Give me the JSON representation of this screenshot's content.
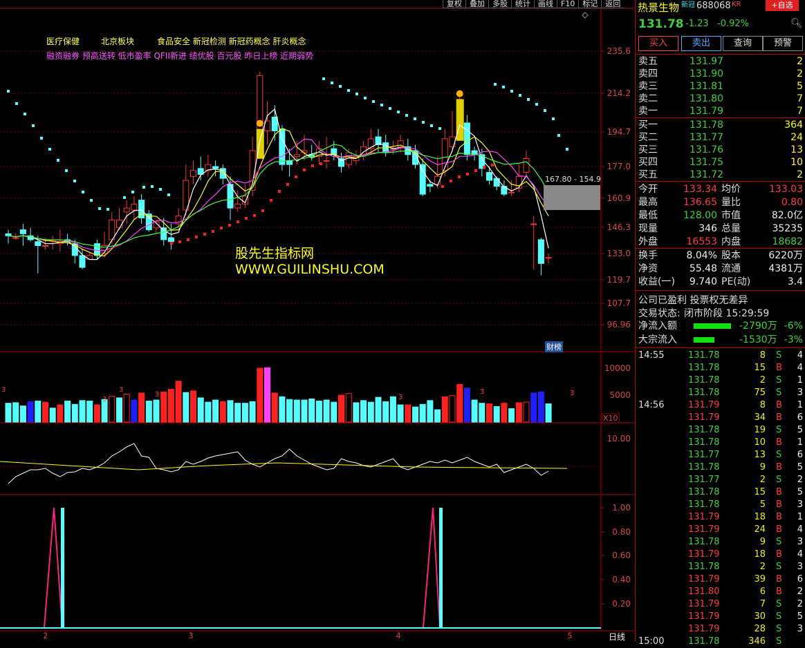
{
  "toolbar": [
    "复权",
    "叠加",
    "多股",
    "统计",
    "画线",
    "F10",
    "标记",
    "返回"
  ],
  "concepts_line1": [
    "医疗保健",
    "北京板块",
    "食品安全 新冠检测 新冠药概念 肝炎概念"
  ],
  "concepts_line2": "融资融券 预高送转 低市盈率 QFII新进 绩优股 百元股 昨日上榜 近期弱势",
  "watermark": {
    "cn": "股先生指标网",
    "url": "WWW.GUILINSHU.COM"
  },
  "price_axis": [
    "235.6",
    "214.2",
    "194.7",
    "177.0",
    "160.9",
    "146.3",
    "133.0",
    "119.7",
    "107.7",
    "96.96"
  ],
  "annotation": "167.80 - 154.9",
  "caibang": "财榜",
  "vol_axis": [
    "10000",
    "5000"
  ],
  "vol_unit": "X10",
  "osc_axis": [
    "10.00"
  ],
  "sig_axis": [
    "1.00",
    "0.80",
    "0.60",
    "0.40",
    "0.20"
  ],
  "x_axis": [
    "2",
    "3",
    "4",
    "5"
  ],
  "period": "日线",
  "vol_marks": [
    "3",
    "3",
    "3",
    "3",
    "3",
    "3",
    "3"
  ],
  "stock": {
    "name": "热景生物",
    "tag": "新冠",
    "code": "688068",
    "suffix": "KR",
    "selfpick": "+自选",
    "price": "131.78",
    "change": "-1.23",
    "pct": "-0.92%"
  },
  "buttons": [
    "买入",
    "卖出",
    "查询",
    "预警"
  ],
  "asks": [
    [
      "卖五",
      "131.97",
      "2"
    ],
    [
      "卖四",
      "131.90",
      "2"
    ],
    [
      "卖三",
      "131.81",
      "5"
    ],
    [
      "卖二",
      "131.80",
      "7"
    ],
    [
      "卖一",
      "131.79",
      "7"
    ]
  ],
  "bids": [
    [
      "买一",
      "131.78",
      "364"
    ],
    [
      "买二",
      "131.77",
      "24"
    ],
    [
      "买三",
      "131.76",
      "13"
    ],
    [
      "买四",
      "131.75",
      "10"
    ],
    [
      "买五",
      "131.72",
      "2"
    ]
  ],
  "stats": [
    [
      "今开",
      "133.34",
      "均价",
      "133.03"
    ],
    [
      "最高",
      "136.65",
      "量比",
      "0.80"
    ],
    [
      "最低",
      "128.00",
      "市值",
      "82.0亿"
    ],
    [
      "现量",
      "346",
      "总量",
      "35235"
    ],
    [
      "外盘",
      "16553",
      "内盘",
      "18682"
    ]
  ],
  "stats2": [
    [
      "换手",
      "8.04%",
      "股本",
      "6220万"
    ],
    [
      "净资",
      "55.48",
      "流通",
      "4381万"
    ],
    [
      "收益(一)",
      "9.740",
      "PE(动)",
      "3.4"
    ]
  ],
  "notice": "公司已盈利 投票权无差异",
  "trade_state": {
    "label": "交易状态:",
    "value": "闭市阶段 15:29:59"
  },
  "flows": [
    [
      "净流入额",
      "-2790万",
      "-6%"
    ],
    [
      "大宗流入",
      "-1530万",
      "-3%"
    ]
  ],
  "ticks": [
    [
      "14:55",
      "131.78",
      "8",
      "S",
      "4"
    ],
    [
      "",
      "131.78",
      "15",
      "B",
      "4"
    ],
    [
      "",
      "131.78",
      "2",
      "S",
      "1"
    ],
    [
      "",
      "131.78",
      "75",
      "S",
      "3"
    ],
    [
      "14:56",
      "131.79",
      "8",
      "B",
      "1"
    ],
    [
      "",
      "131.79",
      "34",
      "B",
      "6"
    ],
    [
      "",
      "131.78",
      "19",
      "S",
      "5"
    ],
    [
      "",
      "131.78",
      "10",
      "B",
      "1"
    ],
    [
      "",
      "131.77",
      "13",
      "S",
      "6"
    ],
    [
      "",
      "131.78",
      "9",
      "B",
      "5"
    ],
    [
      "",
      "131.77",
      "2",
      "S",
      "2"
    ],
    [
      "",
      "131.78",
      "15",
      "B",
      "5"
    ],
    [
      "",
      "131.78",
      "5",
      "B",
      "3"
    ],
    [
      "",
      "131.79",
      "18",
      "B",
      "1"
    ],
    [
      "",
      "131.79",
      "24",
      "B",
      "4"
    ],
    [
      "",
      "131.78",
      "9",
      "S",
      "3"
    ],
    [
      "",
      "131.79",
      "18",
      "B",
      "4"
    ],
    [
      "",
      "131.78",
      "2",
      "S",
      "3"
    ],
    [
      "",
      "131.79",
      "39",
      "B",
      "6"
    ],
    [
      "",
      "131.80",
      "6",
      "B",
      "2"
    ],
    [
      "",
      "131.79",
      "7",
      "S",
      "2"
    ],
    [
      "",
      "131.79",
      "30",
      "S",
      "5"
    ],
    [
      "",
      "131.79",
      "28",
      "S",
      "3"
    ],
    [
      "15:00",
      "131.78",
      "346",
      "S",
      ""
    ]
  ],
  "colors": {
    "up": "#ff3030",
    "down": "#54ffff",
    "grid": "#b00000",
    "ma_white": "#ffffff",
    "ma_yellow": "#ffff00",
    "ma_mag": "#ff40ff",
    "ma_green": "#40ff40"
  }
}
